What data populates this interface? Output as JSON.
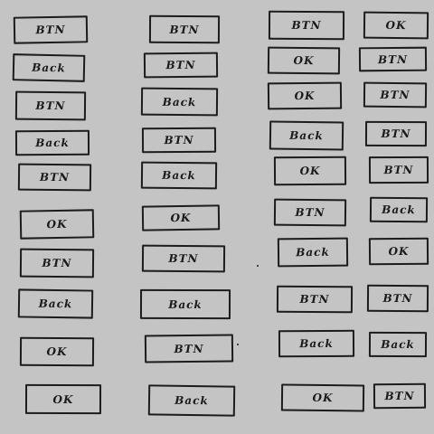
{
  "page": {
    "background": "#c4c4c4",
    "stroke_color": "#1c1c1c"
  },
  "labels": {
    "btn": "BTN",
    "back": "Back",
    "ok": "OK"
  },
  "buttons": [
    {
      "id": "c1-r1",
      "label": "BTN"
    },
    {
      "id": "c1-r2",
      "label": "Back"
    },
    {
      "id": "c1-r3",
      "label": "BTN"
    },
    {
      "id": "c1-r4",
      "label": "Back"
    },
    {
      "id": "c1-r5",
      "label": "BTN"
    },
    {
      "id": "c1-r6",
      "label": "OK"
    },
    {
      "id": "c1-r7",
      "label": "BTN"
    },
    {
      "id": "c1-r8",
      "label": "Back"
    },
    {
      "id": "c1-r9",
      "label": "OK"
    },
    {
      "id": "c1-r10",
      "label": "OK"
    },
    {
      "id": "c2-r1",
      "label": "BTN"
    },
    {
      "id": "c2-r2",
      "label": "BTN"
    },
    {
      "id": "c2-r3",
      "label": "Back"
    },
    {
      "id": "c2-r4",
      "label": "BTN"
    },
    {
      "id": "c2-r5",
      "label": "Back"
    },
    {
      "id": "c2-r6",
      "label": "OK"
    },
    {
      "id": "c2-r7",
      "label": "BTN"
    },
    {
      "id": "c2-r8",
      "label": "Back"
    },
    {
      "id": "c2-r9",
      "label": "BTN"
    },
    {
      "id": "c2-r10",
      "label": "Back"
    },
    {
      "id": "c3-r1",
      "label": "BTN"
    },
    {
      "id": "c3-r2",
      "label": "OK"
    },
    {
      "id": "c3-r3",
      "label": "OK"
    },
    {
      "id": "c3-r4",
      "label": "Back"
    },
    {
      "id": "c3-r5",
      "label": "OK"
    },
    {
      "id": "c3-r6",
      "label": "BTN"
    },
    {
      "id": "c3-r7",
      "label": "Back"
    },
    {
      "id": "c3-r8",
      "label": "BTN"
    },
    {
      "id": "c3-r9",
      "label": "Back"
    },
    {
      "id": "c3-r10",
      "label": "OK"
    },
    {
      "id": "c4-r1",
      "label": "OK"
    },
    {
      "id": "c4-r2",
      "label": "BTN"
    },
    {
      "id": "c4-r3",
      "label": "BTN"
    },
    {
      "id": "c4-r4",
      "label": "BTN"
    },
    {
      "id": "c4-r5",
      "label": "BTN"
    },
    {
      "id": "c4-r6",
      "label": "Back"
    },
    {
      "id": "c4-r7",
      "label": "OK"
    },
    {
      "id": "c4-r8",
      "label": "BTN"
    },
    {
      "id": "c4-r9",
      "label": "Back"
    },
    {
      "id": "c4-r10",
      "label": "BTN"
    }
  ]
}
